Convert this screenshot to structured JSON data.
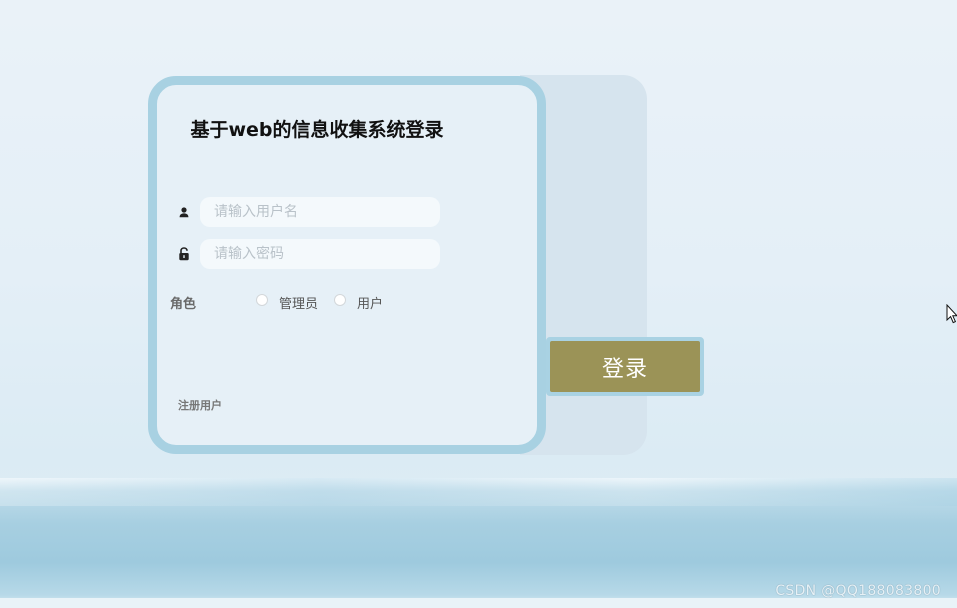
{
  "login": {
    "title": "基于web的信息收集系统登录",
    "username_placeholder": "请输入用户名",
    "password_placeholder": "请输入密码",
    "role_label": "角色",
    "roles": [
      "管理员",
      "用户"
    ],
    "register_link": "注册用户",
    "login_button": "登录"
  },
  "watermark": "CSDN @QQ188083800",
  "colors": {
    "card_border": "#a8d1e2",
    "card_bg": "#e6f0f7",
    "login_button": "#9b9357",
    "back_panel": "#d6e4ee"
  },
  "icons": {
    "username": "user-icon",
    "password": "lock-icon",
    "cursor": "mouse-cursor-icon"
  }
}
